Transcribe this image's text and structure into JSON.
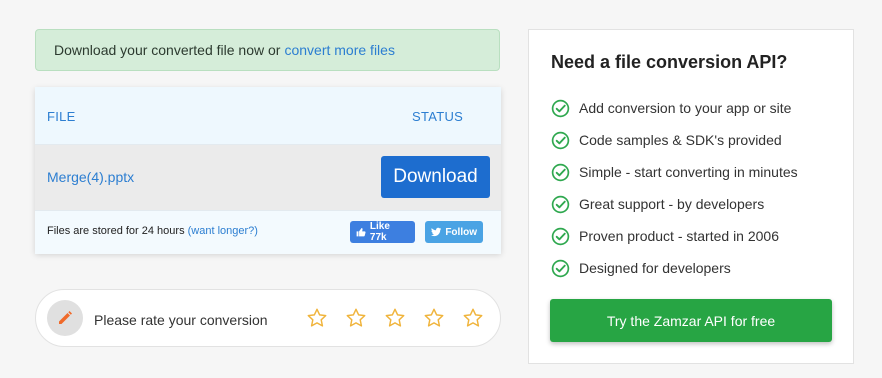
{
  "alert": {
    "text": "Download your converted file now or",
    "link": "convert more files"
  },
  "file_table": {
    "col_file": "FILE",
    "col_status": "STATUS",
    "file_name": "Merge(4).pptx",
    "download_label": "Download",
    "storage_note": "Files are stored for 24 hours",
    "storage_link": "(want longer?)",
    "like_label": "Like 77k",
    "follow_label": "Follow"
  },
  "rating": {
    "prompt": "Please rate your conversion",
    "max_stars": 5,
    "accent_color": "#f0b43c"
  },
  "api_panel": {
    "title": "Need a file conversion API?",
    "features": [
      "Add conversion to your app or site",
      "Code samples & SDK's provided",
      "Simple - start converting in minutes",
      "Great support - by developers",
      "Proven product - started in 2006",
      "Designed for developers"
    ],
    "cta_label": "Try the Zamzar API for free",
    "check_color": "#2fa84f",
    "cta_color": "#27a544"
  },
  "colors": {
    "link": "#2c7ed1",
    "primary_button": "#1d6dcf"
  }
}
